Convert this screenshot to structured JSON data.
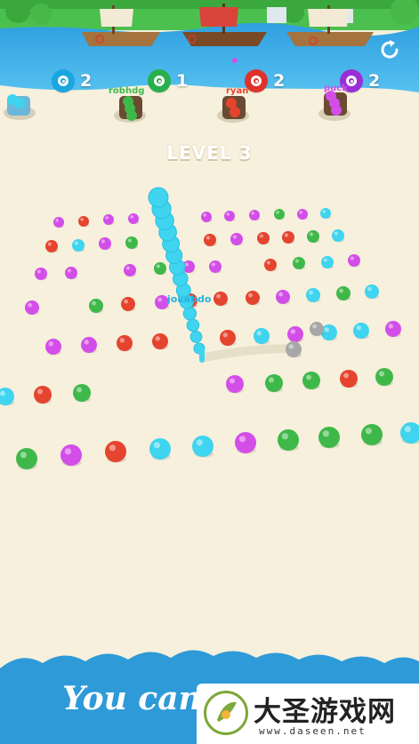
{
  "hud": {
    "scores": [
      {
        "team": "cyan",
        "color": "#1aa6e0",
        "value": "2"
      },
      {
        "team": "green",
        "color": "#27b04b",
        "value": "1"
      },
      {
        "team": "red",
        "color": "#e0322c",
        "value": "2"
      },
      {
        "team": "purple",
        "color": "#9b2fd6",
        "value": "2"
      }
    ],
    "restart_icon": "restart-icon"
  },
  "level": {
    "label": "LEVEL 3"
  },
  "player": {
    "name": "jokabdo",
    "color": "#3fd4ef"
  },
  "cannons": [
    {
      "team": "cyan",
      "name": ""
    },
    {
      "team": "green",
      "name": "robhdg"
    },
    {
      "team": "red",
      "name": "ryan"
    },
    {
      "team": "purple",
      "name": "puck"
    }
  ],
  "colors": {
    "sea": "#3da9e6",
    "sand": "#f6f0dc",
    "grass": "#4cc04f",
    "cyan": "#3fd4ef",
    "green": "#3fb84a",
    "red": "#e5442e",
    "purple": "#d34ee9",
    "gray": "#a7a7a7",
    "banner": "#2e9ad8"
  },
  "footer": {
    "slogan": "You can..."
  },
  "watermark": {
    "site_name": "大圣游戏网",
    "url": "www.daseen.net"
  }
}
